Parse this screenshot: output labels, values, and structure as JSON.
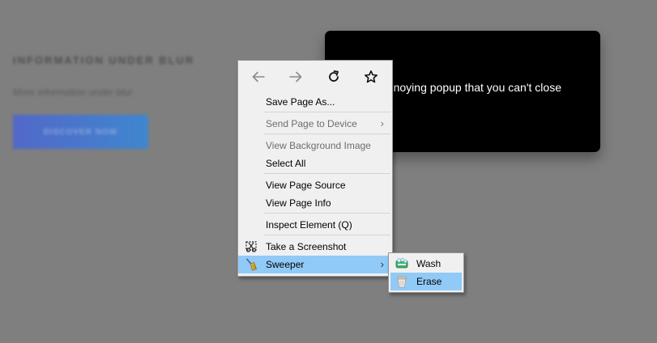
{
  "page": {
    "heading": "INFORMATION UNDER BLUR",
    "subtext": "More information under blur",
    "cta_label": "DISCOVER NOW",
    "popup_text": "An annoying popup that you can't close"
  },
  "context_menu": {
    "nav": {
      "back_icon": "arrow-left-icon",
      "forward_icon": "arrow-right-icon",
      "reload_icon": "reload-icon",
      "bookmark_icon": "star-icon"
    },
    "items": [
      {
        "label": "Save Page As...",
        "enabled": true
      },
      {
        "label": "Send Page to Device",
        "enabled": false,
        "submenu": true
      },
      {
        "label": "View Background Image",
        "enabled": false
      },
      {
        "label": "Select All",
        "enabled": true
      },
      {
        "label": "View Page Source",
        "enabled": true
      },
      {
        "label": "View Page Info",
        "enabled": true
      },
      {
        "label": "Inspect Element (Q)",
        "enabled": true
      },
      {
        "label": "Take a Screenshot",
        "enabled": true,
        "icon": "screenshot-icon"
      },
      {
        "label": "Sweeper",
        "enabled": true,
        "submenu": true,
        "highlighted": true,
        "icon": "broom-icon"
      }
    ],
    "submenu_arrow": "›"
  },
  "sweeper_submenu": {
    "items": [
      {
        "label": "Wash",
        "icon": "wash-icon"
      },
      {
        "label": "Erase",
        "icon": "trash-can-icon",
        "highlighted": true
      }
    ]
  },
  "colors": {
    "highlight": "#91c9f7",
    "menu_background": "#f0f0f0",
    "page_overlay": "#808080",
    "popup_background": "#000000"
  }
}
